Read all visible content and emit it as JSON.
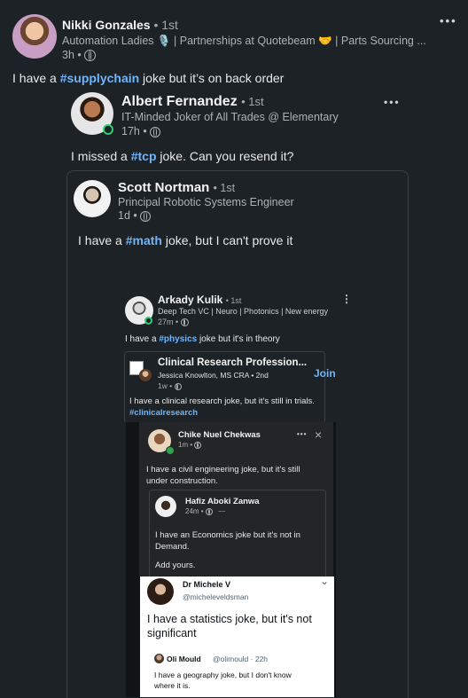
{
  "post1": {
    "author": "Nikki Gonzales",
    "degree": "• 1st",
    "headline": "Automation Ladies 🎙️ | Partnerships at Quotebeam 🤝 | Parts Sourcing ...",
    "time": "3h •",
    "text_before": "I have a ",
    "hashtag": "#supplychain",
    "text_after": " joke but it’s on back order"
  },
  "post2": {
    "author": "Albert Fernandez",
    "degree": "• 1st",
    "headline": "IT-Minded Joker of All Trades @ Elementary",
    "time": "17h •",
    "text_before": "I missed a ",
    "hashtag": "#tcp",
    "text_after": " joke. Can you resend it?"
  },
  "post3": {
    "author": "Scott Nortman",
    "degree": "• 1st",
    "headline": "Principal Robotic Systems Engineer",
    "time": "1d •",
    "text_before": "I have a ",
    "hashtag": "#math",
    "text_after": " joke, but I can't prove it"
  },
  "post4": {
    "author": "Arkady Kulik",
    "degree": "• 1st",
    "headline": "Deep Tech VC | Neuro | Photonics | New energy",
    "time": "27m •",
    "text_before": "I have a ",
    "hashtag": "#physics",
    "text_after": " joke but it's in theory"
  },
  "post5": {
    "group": "Clinical Research Profession...",
    "author": "Jessica Knowlton, MS CRA • 2nd",
    "time": "1w •",
    "join": "Join",
    "text": "I have a clinical research joke, but it’s still in trials.",
    "hashtag": "#clinicalresearch"
  },
  "post6": {
    "author": "Chike Nuel Chekwas",
    "time": "1m •",
    "text": "I have a civil engineering joke, but it's still under construction."
  },
  "post7": {
    "author": "Hafiz Aboki Zanwa",
    "time": "24m •",
    "text1": "I have an Economics joke but it's not in Demand.",
    "text2": "Add yours."
  },
  "post8": {
    "author": "Dr Michele V",
    "handle": "@micheleveldsman",
    "text": "I have a statistics joke, but it's not significant"
  },
  "post9": {
    "author": "Oli Mould",
    "handle_time": "@olimould · 22h",
    "text": "I have a geography joke, but I don't know where it is."
  },
  "icons": {
    "more": "•••",
    "more_vertical": "⋮",
    "close": "×",
    "chevron": "⌄"
  },
  "colors": {
    "background": "#1d2226",
    "hashtag": "#70b5f9",
    "online": "#2ecc71"
  }
}
